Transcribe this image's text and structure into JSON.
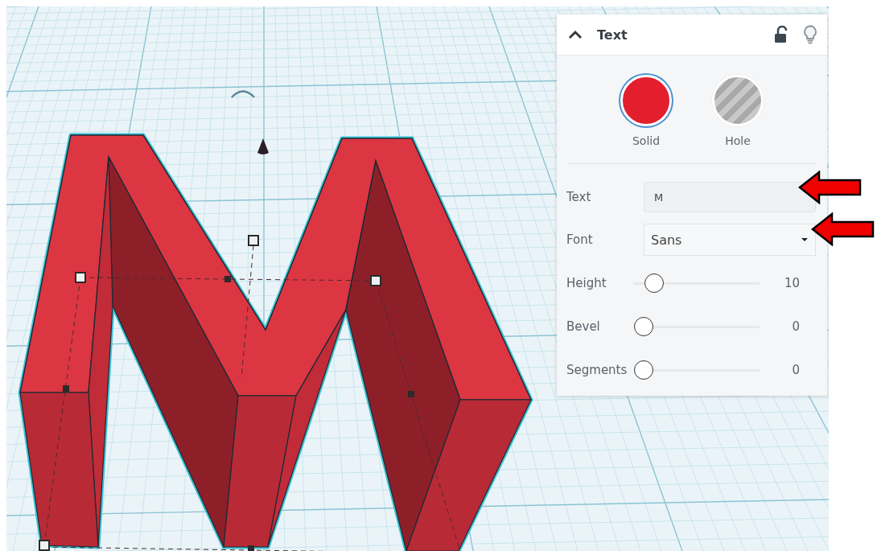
{
  "panel": {
    "title": "Text",
    "shape_types": [
      {
        "label": "Solid",
        "kind": "solid",
        "selected": true
      },
      {
        "label": "Hole",
        "kind": "hole",
        "selected": false
      }
    ],
    "text_field": {
      "label": "Text",
      "value": "M"
    },
    "font_field": {
      "label": "Font",
      "value": "Sans"
    },
    "sliders": [
      {
        "label": "Height",
        "level": 0.1,
        "reading": "10"
      },
      {
        "label": "Bevel",
        "level": 0,
        "reading": "0"
      },
      {
        "label": "Segments",
        "level": 0,
        "reading": "0"
      }
    ]
  },
  "annotation_arrows": [
    {
      "kind": "arrow"
    },
    {
      "kind": "arrow"
    }
  ]
}
